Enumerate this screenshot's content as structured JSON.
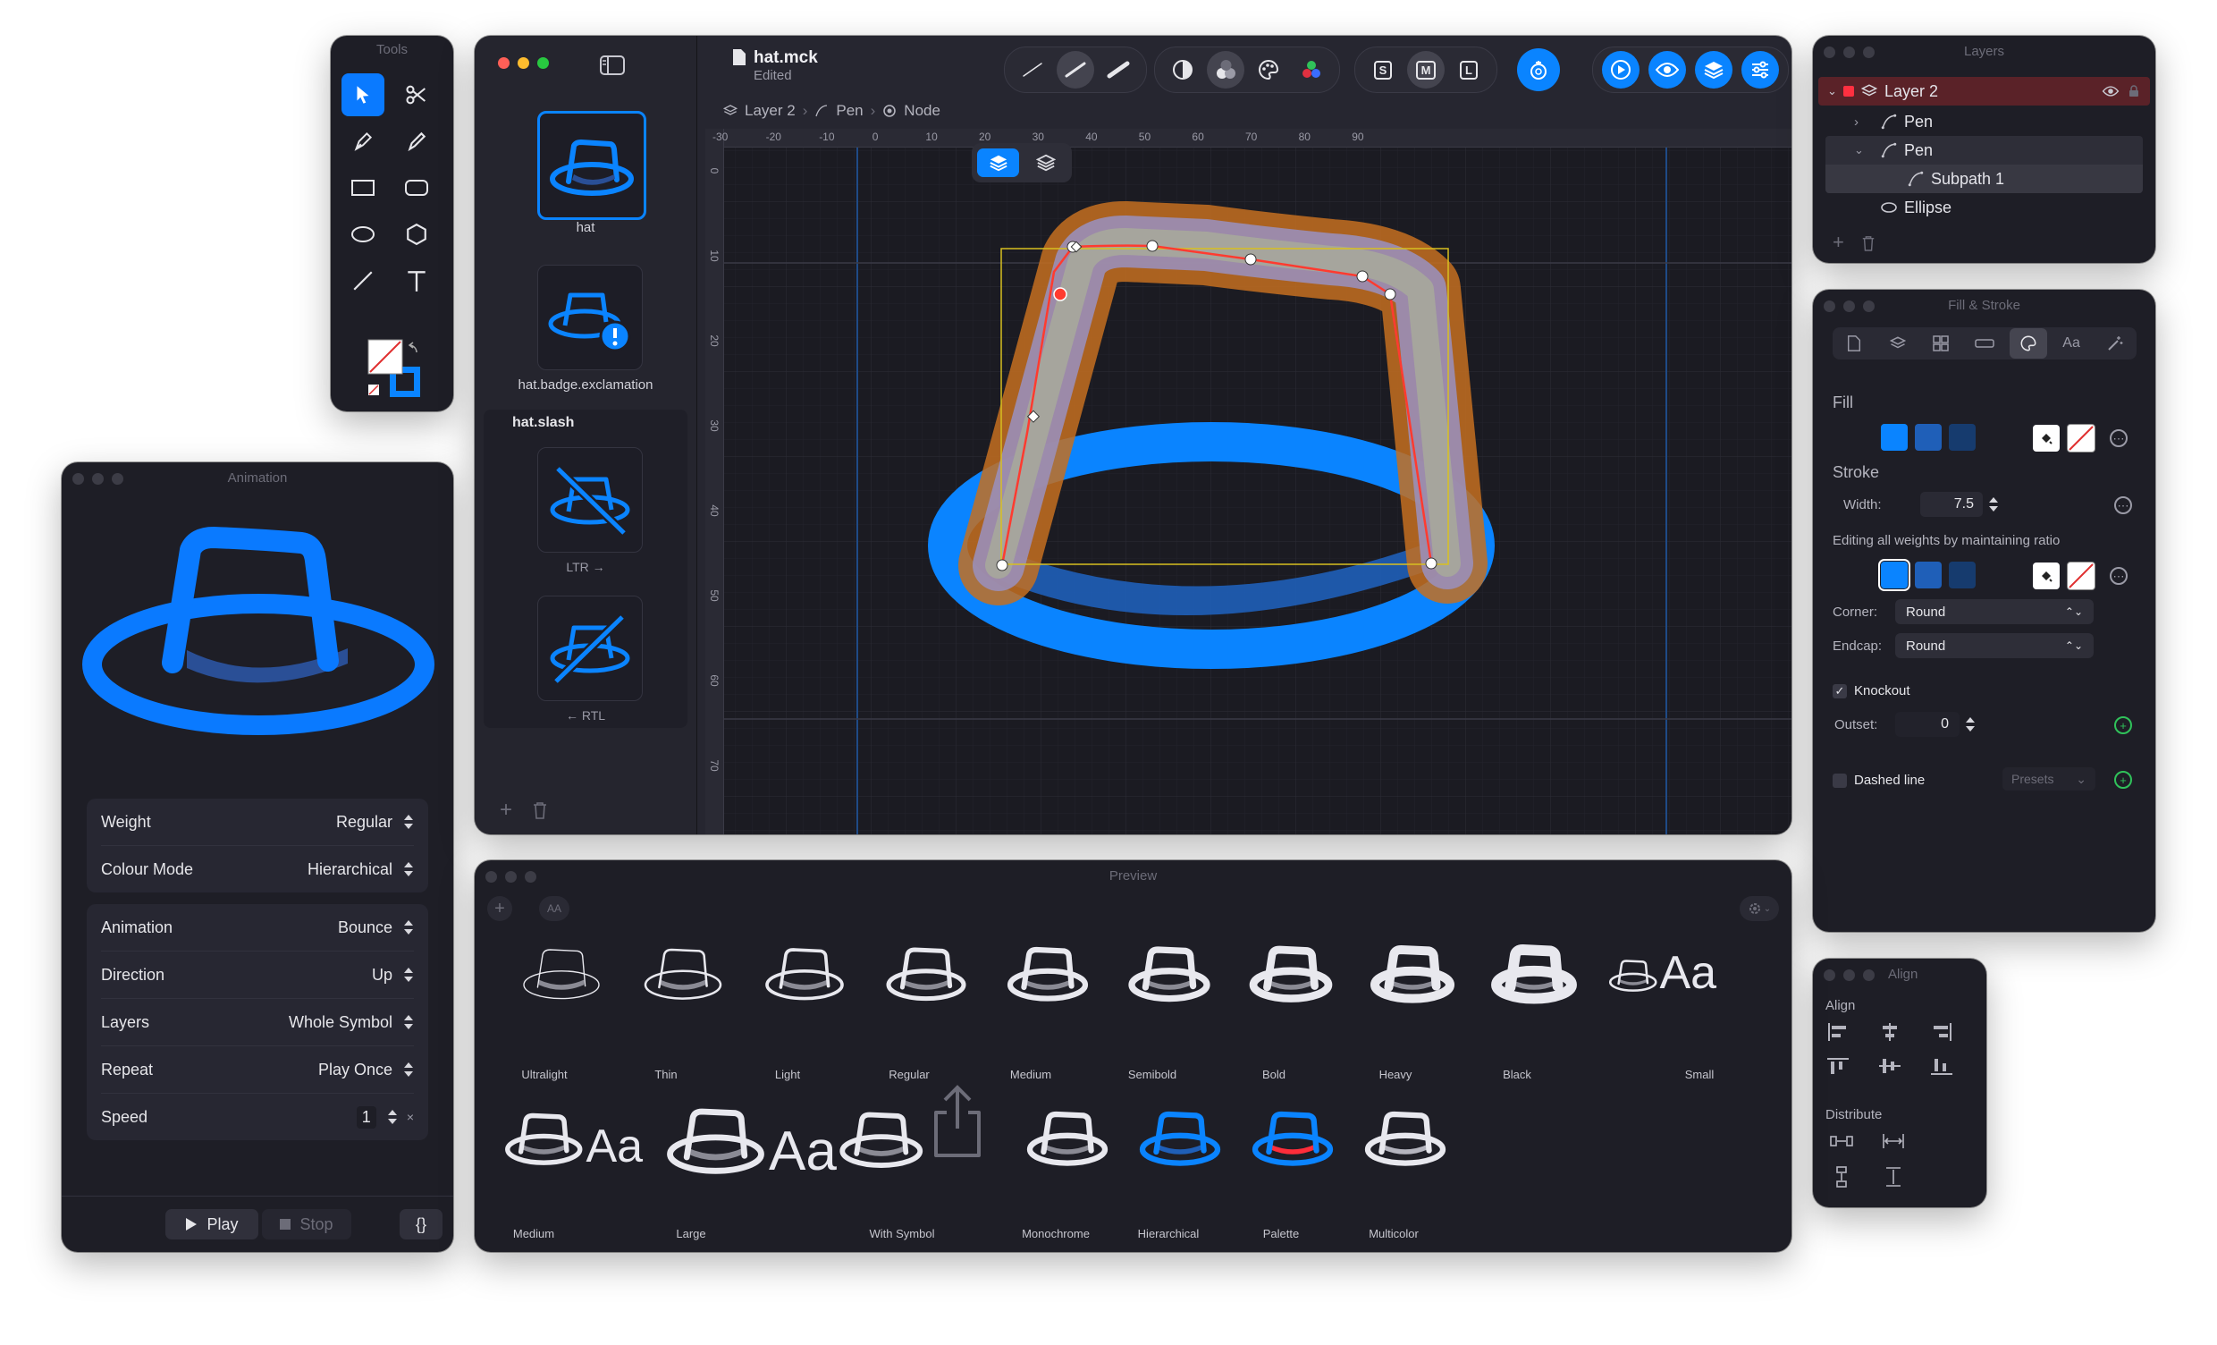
{
  "tools": {
    "title": "Tools"
  },
  "animation": {
    "title": "Animation",
    "rows1": [
      {
        "label": "Weight",
        "value": "Regular"
      },
      {
        "label": "Colour Mode",
        "value": "Hierarchical"
      }
    ],
    "rows2": [
      {
        "label": "Animation",
        "value": "Bounce"
      },
      {
        "label": "Direction",
        "value": "Up"
      },
      {
        "label": "Layers",
        "value": "Whole Symbol"
      },
      {
        "label": "Repeat",
        "value": "Play Once"
      },
      {
        "label": "Speed",
        "value": "1"
      }
    ],
    "speed_suffix": "×",
    "play_label": "Play",
    "stop_label": "Stop",
    "code_label": "{}"
  },
  "document": {
    "filename": "hat.mck",
    "status": "Edited",
    "breadcrumb": [
      "Layer 2",
      "Pen",
      "Node"
    ],
    "symbols": [
      {
        "name": "hat"
      },
      {
        "name": "hat.badge.exclamation"
      }
    ],
    "group_title": "hat.slash",
    "variants": [
      "LTR →",
      "← RTL"
    ],
    "ruler_x": [
      "-30",
      "-20",
      "-10",
      "0",
      "10",
      "20",
      "30",
      "40",
      "50",
      "60",
      "70",
      "80",
      "90"
    ],
    "ruler_y": [
      "0",
      "10",
      "20",
      "30",
      "40",
      "50",
      "60",
      "70"
    ],
    "toolbar_letters": [
      "S",
      "M",
      "L"
    ]
  },
  "layers": {
    "title": "Layers",
    "items": [
      "Layer 2",
      "Pen",
      "Pen",
      "Subpath 1",
      "Ellipse"
    ]
  },
  "fill_stroke": {
    "title": "Fill & Stroke",
    "fill_label": "Fill",
    "stroke_label": "Stroke",
    "width_label": "Width:",
    "width_value": "7.5",
    "hint": "Editing all weights by maintaining ratio",
    "corner_label": "Corner:",
    "corner_value": "Round",
    "endcap_label": "Endcap:",
    "endcap_value": "Round",
    "knockout_label": "Knockout",
    "outset_label": "Outset:",
    "outset_value": "0",
    "dashed_label": "Dashed line",
    "presets_label": "Presets",
    "tab_text": "Aa",
    "colors": {
      "accent": "#0a84ff",
      "mid": "#1f5fb8",
      "dark": "#163b6e"
    }
  },
  "align": {
    "title": "Align",
    "align_label": "Align",
    "distribute_label": "Distribute"
  },
  "preview": {
    "title": "Preview",
    "aa_label": "AA",
    "row1": [
      "Ultralight",
      "Thin",
      "Light",
      "Regular",
      "Medium",
      "Semibold",
      "Bold",
      "Heavy",
      "Black",
      "Small"
    ],
    "row2": [
      "Medium",
      "Large",
      "With Symbol",
      "Monochrome",
      "Hierarchical",
      "Palette",
      "Multicolor"
    ],
    "aa_text": "Aa"
  }
}
